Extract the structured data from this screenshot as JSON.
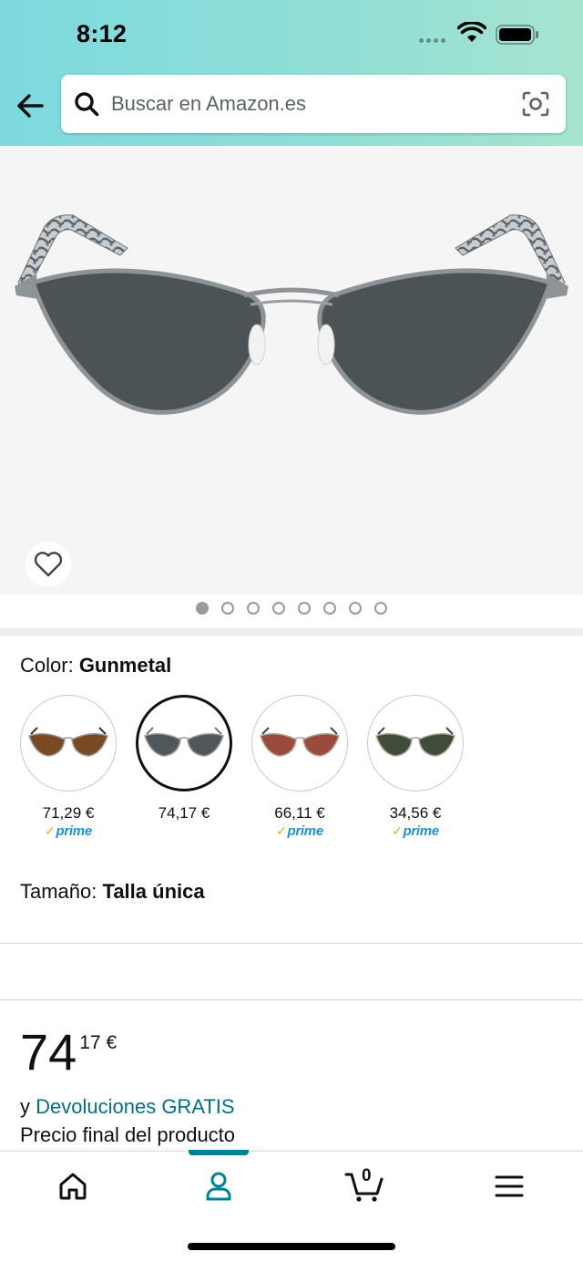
{
  "status_bar": {
    "time": "8:12"
  },
  "search": {
    "placeholder": "Buscar en Amazon.es"
  },
  "gallery": {
    "total_images": 8,
    "current_index": 0
  },
  "color": {
    "label": "Color:",
    "selected_value": "Gunmetal"
  },
  "swatches": [
    {
      "name": "brown-lens",
      "price": "71,29 €",
      "prime": "prime",
      "lens_color": "#7a4a22",
      "selected": false
    },
    {
      "name": "gunmetal",
      "price": "74,17 €",
      "prime": "",
      "lens_color": "#50575a",
      "selected": true
    },
    {
      "name": "rose-lens",
      "price": "66,11 €",
      "prime": "prime",
      "lens_color": "#9a4b3e",
      "selected": false
    },
    {
      "name": "green-lens",
      "price": "34,56 €",
      "prime": "prime",
      "lens_color": "#3f4b3b",
      "selected": false
    }
  ],
  "size": {
    "label": "Tamaño:",
    "value": "Talla única"
  },
  "price": {
    "whole": "74",
    "fraction": "17 €"
  },
  "returns": {
    "prefix": "y",
    "link": "Devoluciones GRATIS"
  },
  "final_price_text": "Precio final del producto",
  "bottom_nav": {
    "cart_count": "0",
    "active_tab": "account"
  },
  "colors": {
    "accent": "#008296",
    "link": "#007185",
    "prime_blue": "#1f8fd6",
    "prime_check": "#f7a21b"
  }
}
